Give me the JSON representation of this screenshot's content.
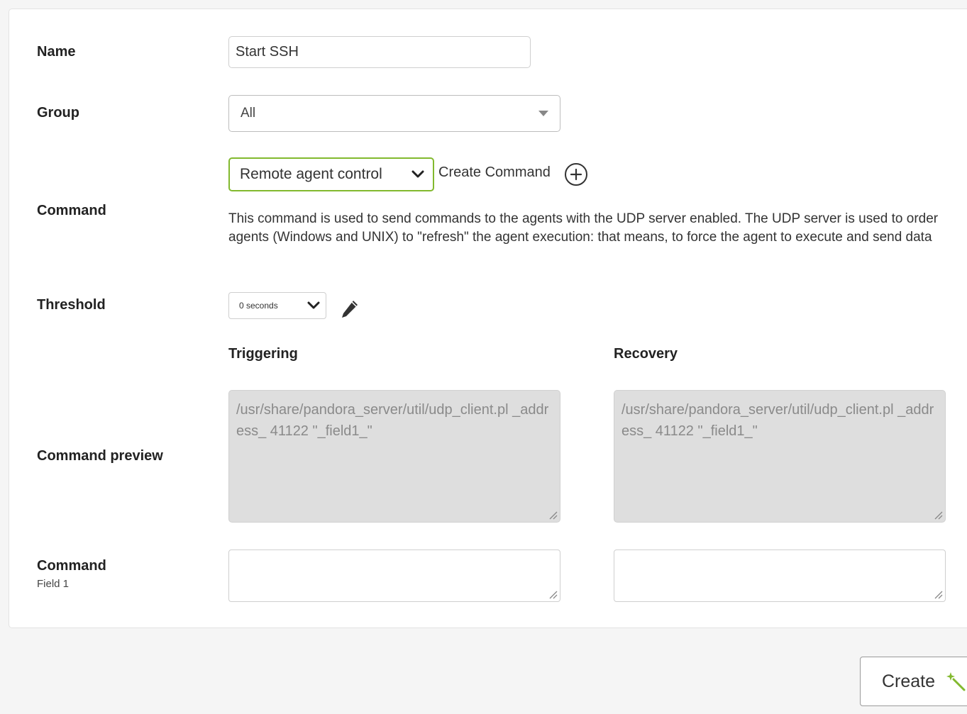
{
  "form": {
    "name_label": "Name",
    "name_value": "Start SSH",
    "group_label": "Group",
    "group_value": "All",
    "command_label": "Command",
    "command_value": "Remote agent control",
    "create_command_label": "Create Command",
    "command_description": "This command is used to send commands to the agents with the UDP server enabled. The UDP server is used to order agents (Windows and UNIX) to \"refresh\" the agent execution: that means, to force the agent to execute and send data",
    "threshold_label": "Threshold",
    "threshold_value": "0 seconds",
    "triggering_label": "Triggering",
    "recovery_label": "Recovery",
    "command_preview_label": "Command preview",
    "triggering_preview": "/usr/share/pandora_server/util/udp_client.pl _address_ 41122 \"_field1_\"",
    "recovery_preview": "/usr/share/pandora_server/util/udp_client.pl _address_ 41122 \"_field1_\"",
    "field_label": "Command",
    "field_sublabel": "Field 1",
    "triggering_field1": "",
    "recovery_field1": ""
  },
  "actions": {
    "create_label": "Create"
  },
  "colors": {
    "accent": "#82b92e",
    "preview_bg": "#dedede"
  },
  "icons": [
    "chevron-down-icon",
    "plus-circle-icon",
    "pencil-icon",
    "wand-icon"
  ]
}
